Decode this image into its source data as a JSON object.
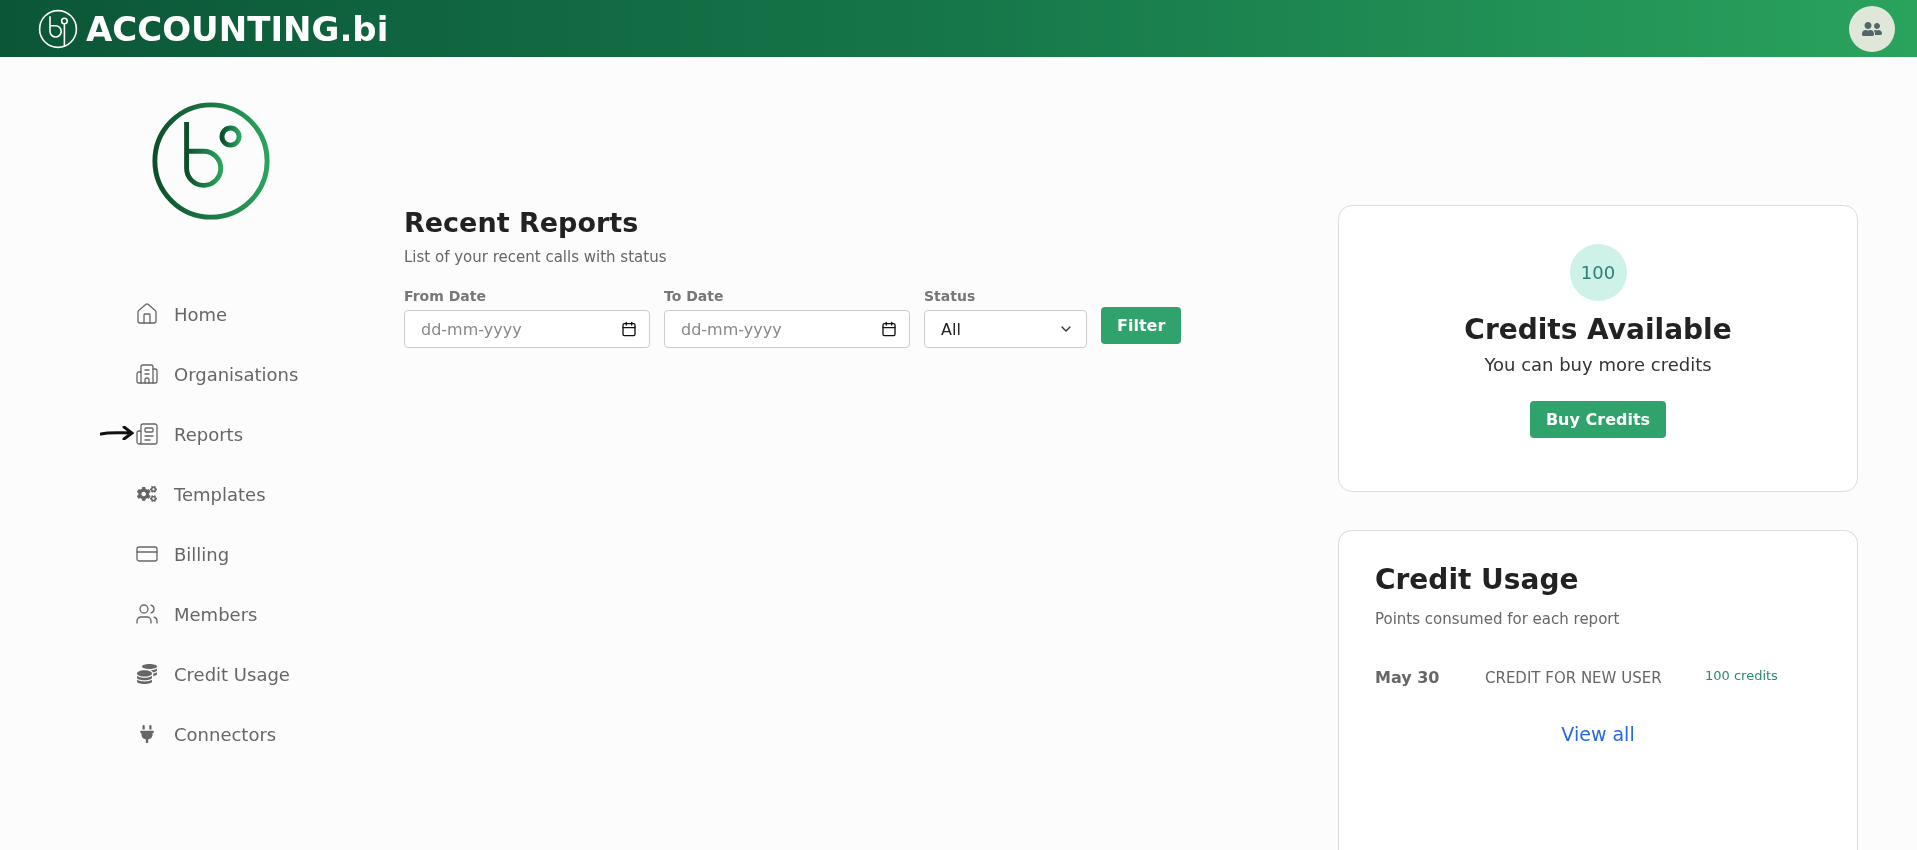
{
  "header": {
    "brand": "ACCOUNTING.bi"
  },
  "sidebar": {
    "items": [
      {
        "label": "Home"
      },
      {
        "label": "Organisations"
      },
      {
        "label": "Reports"
      },
      {
        "label": "Templates"
      },
      {
        "label": "Billing"
      },
      {
        "label": "Members"
      },
      {
        "label": "Credit Usage"
      },
      {
        "label": "Connectors"
      }
    ]
  },
  "reports": {
    "title": "Recent Reports",
    "subtitle": "List of your recent calls with status",
    "filters": [
      {
        "kind": "date",
        "label": "From Date",
        "placeholder": "dd-mm-yyyy"
      },
      {
        "kind": "date",
        "label": "To Date",
        "placeholder": "dd-mm-yyyy"
      },
      {
        "kind": "select",
        "label": "Status",
        "value": "All"
      }
    ],
    "filter_button": "Filter"
  },
  "credits": {
    "count": "100",
    "title": "Credits Available",
    "subtitle": "You can buy more credits",
    "button": "Buy Credits"
  },
  "usage": {
    "title": "Credit Usage",
    "subtitle": "Points consumed for each report",
    "rows": [
      {
        "date": "May 30",
        "description": "CREDIT FOR NEW USER",
        "amount": "100 credits"
      }
    ],
    "link": "View all"
  }
}
